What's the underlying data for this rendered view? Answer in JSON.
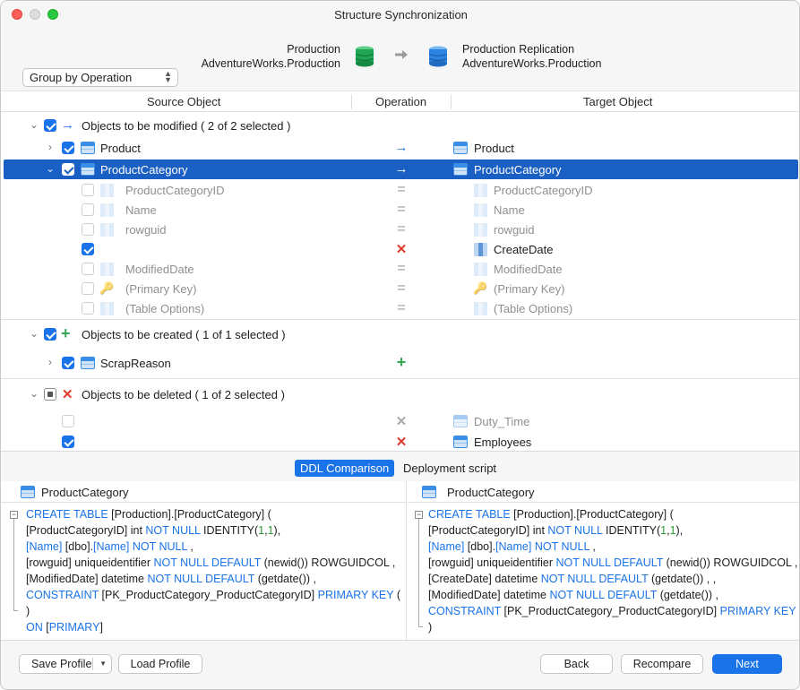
{
  "window": {
    "title": "Structure Synchronization"
  },
  "header": {
    "source": {
      "line1": "Production",
      "line2": "AdventureWorks.Production"
    },
    "target": {
      "line1": "Production Replication",
      "line2": "AdventureWorks.Production"
    },
    "group_by": {
      "value": "Group by Operation"
    }
  },
  "columns": {
    "source": "Source Object",
    "operation": "Operation",
    "target": "Target Object"
  },
  "groups": {
    "modified": {
      "label": "Objects to be modified ( 2 of 2 selected )"
    },
    "created": {
      "label": "Objects to be created ( 1 of 1 selected )"
    },
    "deleted": {
      "label": "Objects to be deleted ( 1 of 2 selected )"
    }
  },
  "rows": {
    "product": {
      "source": "Product",
      "target": "Product"
    },
    "product_category": {
      "source": "ProductCategory",
      "target": "ProductCategory"
    },
    "col_id": {
      "source": "ProductCategoryID",
      "target": "ProductCategoryID"
    },
    "col_name": {
      "source": "Name",
      "target": "Name"
    },
    "col_rowguid": {
      "source": "rowguid",
      "target": "rowguid"
    },
    "col_createdate": {
      "source": "",
      "target": "CreateDate"
    },
    "col_modified": {
      "source": "ModifiedDate",
      "target": "ModifiedDate"
    },
    "col_pk": {
      "source": "(Primary Key)",
      "target": "(Primary Key)"
    },
    "col_opts": {
      "source": "(Table Options)",
      "target": "(Table Options)"
    },
    "scrap_reason": {
      "source": "ScrapReason"
    },
    "duty_time": {
      "target": "Duty_Time"
    },
    "employees": {
      "target": "Employees"
    }
  },
  "tabs": {
    "ddl": "DDL Comparison",
    "deploy": "Deployment script"
  },
  "ddl": {
    "left": {
      "title": "ProductCategory",
      "l1a": "CREATE TABLE",
      "l1b": " [Production].[ProductCategory] (",
      "l2a": "[ProductCategoryID] int ",
      "l2b": "NOT NULL",
      "l2c": " IDENTITY(",
      "l2d": "1",
      "l2e": ",",
      "l2f": "1",
      "l2g": "),",
      "l3a": "[Name]",
      "l3b": " [dbo].",
      "l3c": "[Name]",
      "l3d": " NOT NULL",
      "l3e": " ,",
      "l4a": "[rowguid] uniqueidentifier ",
      "l4b": "NOT NULL DEFAULT",
      "l4c": " (newid()) ROWGUIDCOL ,",
      "l5a": "[ModifiedDate] datetime ",
      "l5b": "NOT NULL DEFAULT",
      "l5c": " (getdate()) ,",
      "l6a": "CONSTRAINT",
      "l6b": " [PK_ProductCategory_ProductCategoryID] ",
      "l6c": "PRIMARY KEY",
      "l6d": " (",
      "l7": ")",
      "l8a": "ON",
      "l8b": " [",
      "l8c": "PRIMARY",
      "l8d": "]"
    },
    "right": {
      "title": "ProductCategory",
      "l1a": "CREATE TABLE",
      "l1b": " [Production].[ProductCategory] (",
      "l2a": "[ProductCategoryID] int ",
      "l2b": "NOT NULL",
      "l2c": " IDENTITY(",
      "l2d": "1",
      "l2e": ",",
      "l2f": "1",
      "l2g": "),",
      "l3a": "[Name]",
      "l3b": " [dbo].",
      "l3c": "[Name]",
      "l3d": " NOT NULL",
      "l3e": " ,",
      "l4a": "[rowguid] uniqueidentifier ",
      "l4b": "NOT NULL DEFAULT",
      "l4c": " (newid()) ROWGUIDCOL ,",
      "l5a": "[CreateDate] datetime ",
      "l5b": "NOT NULL DEFAULT",
      "l5c": " (getdate()) , ,",
      "l6a": "[ModifiedDate] datetime ",
      "l6b": "NOT NULL DEFAULT",
      "l6c": " (getdate()) ,",
      "l7a": "CONSTRAINT",
      "l7b": " [PK_ProductCategory_ProductCategoryID] ",
      "l7c": "PRIMARY KEY",
      "l7d": " (",
      "l8": ")"
    }
  },
  "footer": {
    "save": "Save Profile",
    "load": "Load Profile",
    "back": "Back",
    "recompare": "Recompare",
    "next": "Next"
  },
  "icons": {
    "arrow": "→",
    "equal": "=",
    "cross": "✕",
    "plus": "+",
    "disclosure_open": "⌄",
    "disclosure_closed": "›",
    "key": "🔑"
  },
  "colors": {
    "accent": "#1a73e8",
    "selection": "#1a5fc4",
    "add": "#34a853",
    "delete": "#e03b2f"
  }
}
